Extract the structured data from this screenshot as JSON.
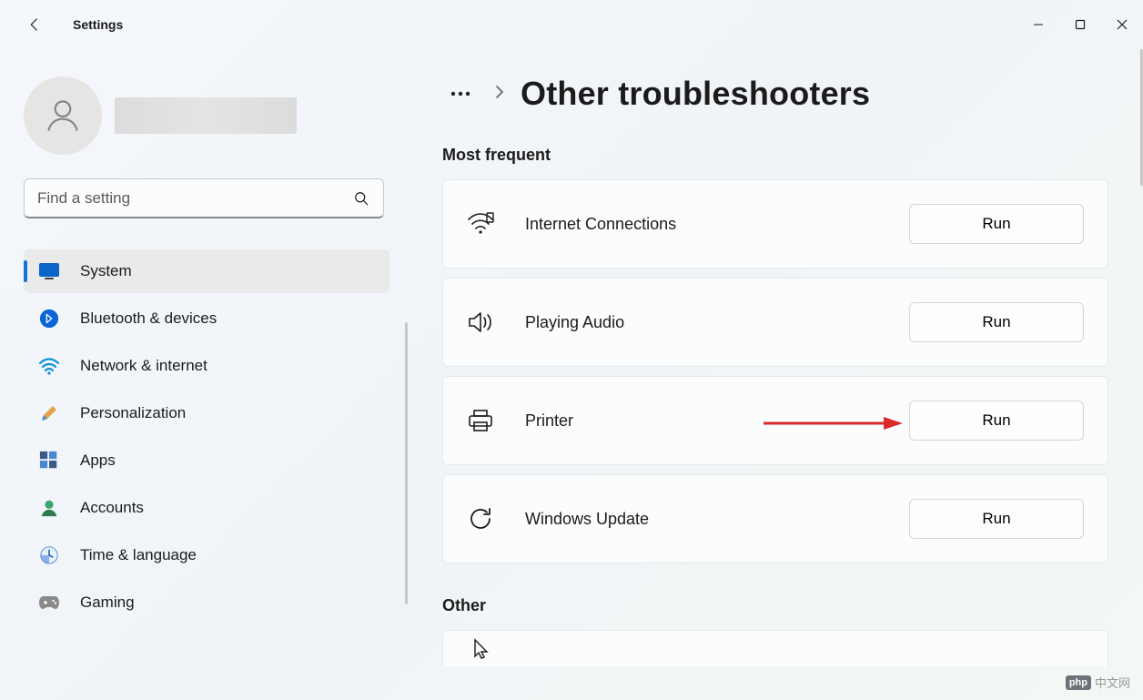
{
  "window": {
    "app_title": "Settings"
  },
  "search": {
    "placeholder": "Find a setting"
  },
  "nav": {
    "items": [
      {
        "id": "system",
        "label": "System",
        "selected": true
      },
      {
        "id": "bluetooth",
        "label": "Bluetooth & devices",
        "selected": false
      },
      {
        "id": "network",
        "label": "Network & internet",
        "selected": false
      },
      {
        "id": "personalization",
        "label": "Personalization",
        "selected": false
      },
      {
        "id": "apps",
        "label": "Apps",
        "selected": false
      },
      {
        "id": "accounts",
        "label": "Accounts",
        "selected": false
      },
      {
        "id": "time",
        "label": "Time & language",
        "selected": false
      },
      {
        "id": "gaming",
        "label": "Gaming",
        "selected": false
      }
    ]
  },
  "breadcrumb": {
    "page_title": "Other troubleshooters"
  },
  "sections": {
    "most_frequent_label": "Most frequent",
    "other_label": "Other"
  },
  "troubleshooters": [
    {
      "id": "internet",
      "label": "Internet Connections",
      "button": "Run"
    },
    {
      "id": "audio",
      "label": "Playing Audio",
      "button": "Run"
    },
    {
      "id": "printer",
      "label": "Printer",
      "button": "Run"
    },
    {
      "id": "windowsupdate",
      "label": "Windows Update",
      "button": "Run"
    }
  ],
  "watermark": {
    "brand": "php",
    "text": "中文网"
  },
  "annotation": {
    "arrow_color": "#d92b2b"
  }
}
